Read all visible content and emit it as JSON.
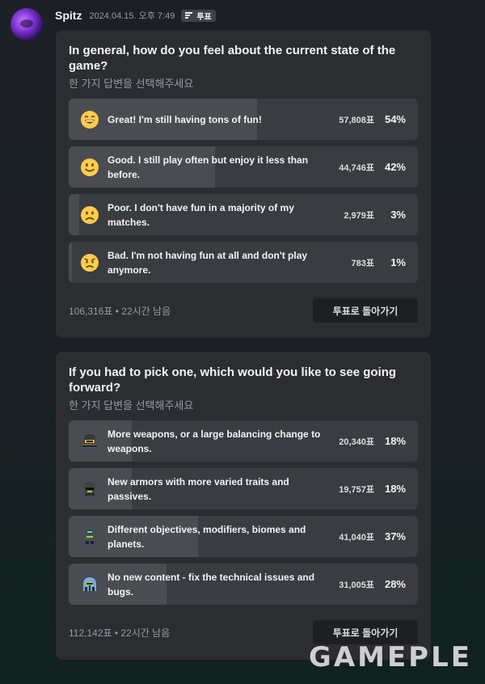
{
  "message": {
    "username": "Spitz",
    "timestamp": "2024.04.15. 오후 7:49",
    "tag": "투표"
  },
  "polls": [
    {
      "question": "In general, how do you feel about the current state of the game?",
      "subtitle": "한 가지 답변을 선택해주세요",
      "answers": [
        {
          "icon": "grinning-face-icon",
          "text": "Great! I'm still having tons of fun!",
          "votes": "57,808표",
          "percent": "54%",
          "fraction": 0.54
        },
        {
          "icon": "slightly-smiling-face-icon",
          "text": "Good. I still play often but enjoy it less than before.",
          "votes": "44,746표",
          "percent": "42%",
          "fraction": 0.42
        },
        {
          "icon": "frowning-face-icon",
          "text": "Poor. I don't have fun in a majority of my matches.",
          "votes": "2,979표",
          "percent": "3%",
          "fraction": 0.03
        },
        {
          "icon": "angry-face-icon",
          "text": "Bad. I'm not having fun at all and don't play anymore.",
          "votes": "783표",
          "percent": "1%",
          "fraction": 0.01
        }
      ],
      "footer": "106,316표 • 22시간 남음",
      "back_label": "투표로 돌아가기"
    },
    {
      "question": "If you had to pick one, which would you like to see going forward?",
      "subtitle": "한 가지 답변을 선택해주세요",
      "answers": [
        {
          "icon": "weapon-helmet-icon",
          "text": "More weapons, or a large balancing change to weapons.",
          "votes": "20,340표",
          "percent": "18%",
          "fraction": 0.18
        },
        {
          "icon": "armor-helmet-icon",
          "text": "New armors with more varied traits and passives.",
          "votes": "19,757표",
          "percent": "18%",
          "fraction": 0.18
        },
        {
          "icon": "planet-soldier-icon",
          "text": "Different objectives, modifiers, biomes and planets.",
          "votes": "41,040표",
          "percent": "37%",
          "fraction": 0.37
        },
        {
          "icon": "repair-helmet-icon",
          "text": "No new content - fix the technical issues and bugs.",
          "votes": "31,005표",
          "percent": "28%",
          "fraction": 0.28
        }
      ],
      "footer": "112,142표 • 22시간 남음",
      "back_label": "투표로 돌아가기"
    }
  ],
  "watermark": "GAMEPLE",
  "colors": {
    "background": "#1c2026",
    "card": "#2b2d31",
    "answer": "#3a3c42",
    "fill": "#4a4c52",
    "emoji": "#ffcc4d"
  }
}
